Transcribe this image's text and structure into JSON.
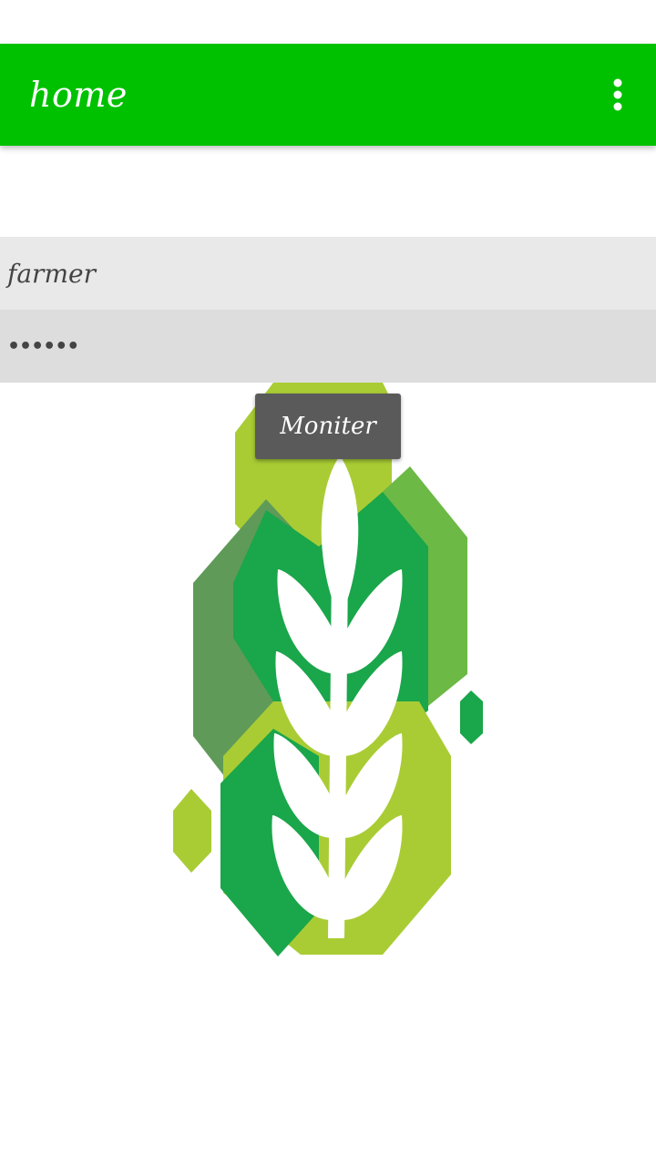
{
  "app_bar": {
    "title": "home",
    "overflow_icon": "more-vert-icon",
    "color": "#00c100"
  },
  "form": {
    "username_value": "farmer",
    "password_value": "••••••"
  },
  "actions": {
    "moniter_label": "Moniter"
  },
  "logo": {
    "icon": "wheat-leaf-logo",
    "colors": [
      "#a9cc35",
      "#1aa64a",
      "#6cb945",
      "#5f9a58"
    ]
  }
}
